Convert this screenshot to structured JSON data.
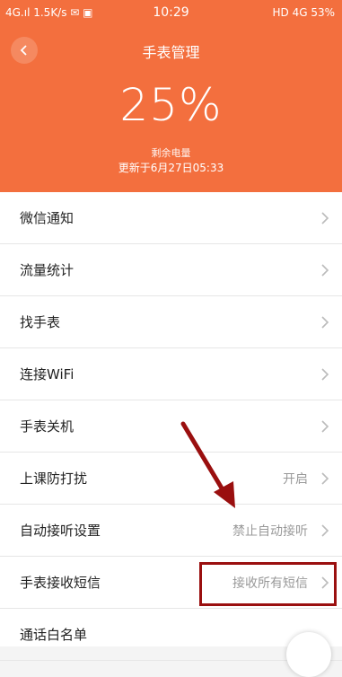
{
  "status_bar": {
    "left": "4G.ıl  1.5K/s ✉ ▣",
    "time": "10:29",
    "right": "HD 4G 53%"
  },
  "header": {
    "title": "手表管理",
    "battery_percent": "25%",
    "battery_label": "剩余电量",
    "updated": "更新于6月27日05:33"
  },
  "menu": [
    {
      "label": "微信通知",
      "value": ""
    },
    {
      "label": "流量统计",
      "value": ""
    },
    {
      "label": "找手表",
      "value": ""
    },
    {
      "label": "连接WiFi",
      "value": ""
    },
    {
      "label": "手表关机",
      "value": ""
    },
    {
      "label": "上课防打扰",
      "value": "开启"
    },
    {
      "label": "自动接听设置",
      "value": "禁止自动接听"
    },
    {
      "label": "手表接收短信",
      "value": "接收所有短信"
    },
    {
      "label": "通话白名单",
      "value": ""
    }
  ],
  "colors": {
    "accent": "#f36f3e",
    "annotation": "#9a0f0f"
  }
}
